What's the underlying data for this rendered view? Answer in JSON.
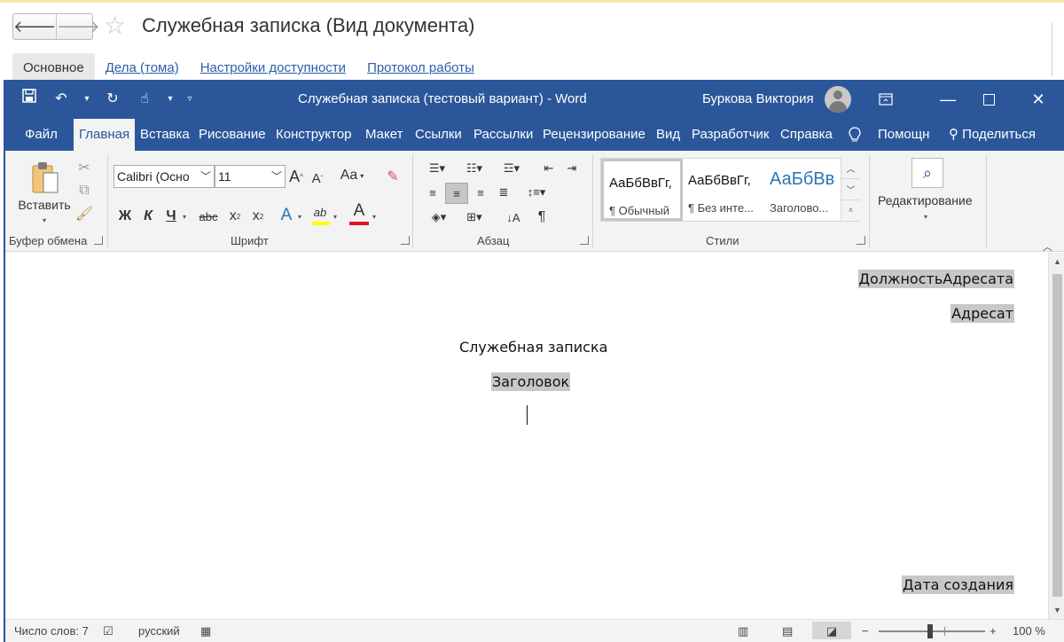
{
  "onec": {
    "title": "Служебная записка (Вид документа)",
    "nav_back": "🡐",
    "nav_forward": "🡒",
    "favorite_icon": "star-icon",
    "tabs": [
      "Основное",
      "Дела (тома)",
      "Настройки доступности",
      "Протокол работы"
    ],
    "active_tab": 0
  },
  "word": {
    "window_title": "Служебная записка (тестовый вариант)  -  Word",
    "user_name": "Буркова Виктория",
    "window_controls": [
      "restore-ribbon-icon",
      "minimize-icon",
      "maximize-icon",
      "close-icon"
    ],
    "ribbon_tabs": [
      "Файл",
      "Главная",
      "Вставка",
      "Рисование",
      "Конструктор",
      "Макет",
      "Ссылки",
      "Рассылки",
      "Рецензирование",
      "Вид",
      "Разработчик",
      "Справка",
      "Помощн",
      "Поделиться"
    ],
    "active_ribbon_tab": "Главная",
    "groups": {
      "clipboard": "Буфер обмена",
      "font": "Шрифт",
      "paragraph": "Абзац",
      "styles": "Стили"
    },
    "paste_label": "Вставить",
    "font_name": "Calibri (Осно",
    "font_size": "11",
    "grow_font": "A",
    "shrink_font": "A",
    "change_case": "Aa",
    "bold": "Ж",
    "italic": "К",
    "underline": "Ч",
    "strikethrough": "abc",
    "subscript": "x",
    "superscript": "x",
    "text_effects": "A",
    "highlight": "ab",
    "font_color": "A",
    "pilcrow": "¶",
    "styles": [
      {
        "sample": "АаБбВвГг,",
        "name": "¶ Обычный"
      },
      {
        "sample": "АаБбВвГг,",
        "name": "¶ Без инте..."
      },
      {
        "sample": "АаБбВв",
        "name": "Заголово..."
      }
    ],
    "editing_label": "Редактирование",
    "document": {
      "recipient_position": "ДолжностьАдресата",
      "recipient": "Адресат",
      "doc_type": "Служебная записка",
      "heading": "Заголовок",
      "created_date": "Дата создания"
    },
    "status": {
      "word_count": "Число слов: 7",
      "language": "русский",
      "zoom_minus": "−",
      "zoom_plus": "+",
      "zoom": "100 %",
      "zoom_level": 1.0
    },
    "colors": {
      "titlebar": "#2b579a",
      "ribbon": "#f3f3f3",
      "field_shading": "#c8c8c8",
      "font_color_bar": "#e81123",
      "highlight_bar": "#ffff00"
    }
  }
}
